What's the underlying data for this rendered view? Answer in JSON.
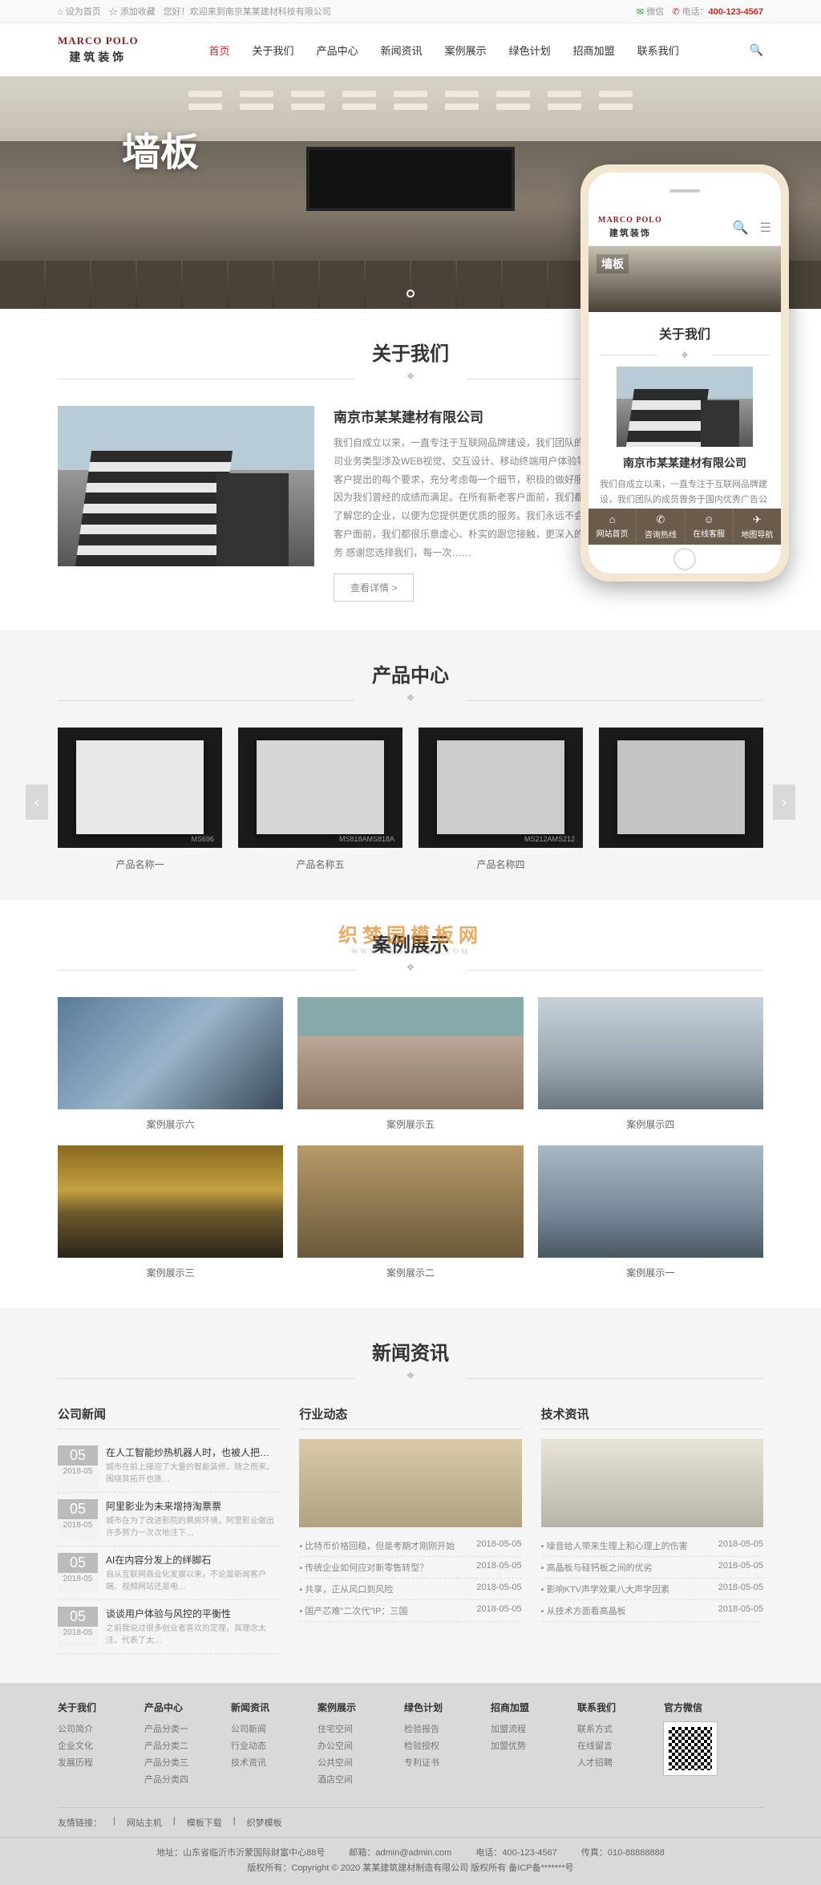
{
  "topbar": {
    "set_home": "设为首页",
    "add_fav": "添加收藏",
    "welcome": "您好！欢迎来到南京某某建材科技有限公司",
    "wechat": "微信",
    "phone_label": "电话：",
    "phone": "400-123-4567"
  },
  "logo": {
    "top": "MARCO POLO",
    "bot": "建筑装饰"
  },
  "nav": [
    "首页",
    "关于我们",
    "产品中心",
    "新闻资讯",
    "案例展示",
    "绿色计划",
    "招商加盟",
    "联系我们"
  ],
  "banner": {
    "title": "墙板"
  },
  "about": {
    "sec": "关于我们",
    "company": "南京市某某建材有限公司",
    "desc": "我们自成立以来，一直专注于互联网品牌建设，我们团队的成员曾务于国内优秀广告公司及互联网公司业务类型涉及WEB视觉、交互设计、移动终端用户体验等质量和信誉是我们存在的基石。我们注重客户提出的每个要求，充分考虑每一个细节，积极的做好服务，努力开拓更好的视野。我们永远不会因为我们曾经的成绩而满足。在所有新老客户面前，我们都很乐意虚心、朴实的跟您接触，更深入的了解您的企业，以便为您提供更优质的服务。我们永远不会因为我们曾经的成绩而满足。在所有新老客户面前，我们都很乐意虚心、朴实的跟您接触，更深入的了解您的企业，以便为您提供更优质的服务 感谢您选择我们，每一次……",
    "btn": "查看详情 >"
  },
  "phone": {
    "about": "关于我们",
    "company": "南京市某某建材有限公司",
    "desc": "我们自成立以来，一直专注于互联网品牌建设，我们团队的成员曾务于国内优秀广告公司及互联网公司业务类型涉及WEB视觉、交互设计、移动终端用户体验等质量和信誉是我们存在的基石。我们注重客户提出的每个要求，充分考虑每一个细节，积极的做好服务，努力开拓更好的视野。我们永远不会因为我们曾经的成绩而满足。在所有新老客户面前，我们都",
    "tabs": [
      {
        "icon": "⌂",
        "t": "网站首页"
      },
      {
        "icon": "✆",
        "t": "咨询热线"
      },
      {
        "icon": "☺",
        "t": "在线客服"
      },
      {
        "icon": "✈",
        "t": "地图导航"
      }
    ]
  },
  "products": {
    "sec": "产品中心",
    "items": [
      {
        "code": "MS696",
        "name": "产品名称一"
      },
      {
        "code": "MS818AMS818A",
        "name": "产品名称五"
      },
      {
        "code": "MS212AMS212",
        "name": "产品名称四"
      },
      {
        "code": "",
        "name": ""
      }
    ]
  },
  "cases": {
    "sec": "案例展示",
    "items": [
      "案例展示六",
      "案例展示五",
      "案例展示四",
      "案例展示三",
      "案例展示二",
      "案例展示一"
    ]
  },
  "news": {
    "sec": "新闻资讯",
    "cols": [
      {
        "title": "公司新闻",
        "date_day": "05",
        "date_ym": "2018-05",
        "items": [
          {
            "t": "在人工智能炒热机器人时，也被人把…",
            "d": "城市在前上接迎了大量的智能装修，随之而来，围绕其拓开也逐…"
          },
          {
            "t": "阿里影业为未来增持淘票票",
            "d": "城市在为了改进影院的票房环境，阿里影业做出许多努力一次次地注下…"
          },
          {
            "t": "AI在内容分发上的绊脚石",
            "d": "自从互联网商业化发展以来，不论是新闻客户端、视频网站还是电…"
          },
          {
            "t": "谈谈用户体验与风控的平衡性",
            "d": "之前我说过很多创业者喜欢的定理，其理念太注、代表了太…"
          }
        ]
      },
      {
        "title": "行业动态",
        "links": [
          {
            "t": "比特币价格回稳，但是考期才刚刚开始",
            "d": "2018-05-05"
          },
          {
            "t": "传统企业如何应对新零售转型？",
            "d": "2018-05-05"
          },
          {
            "t": "共享，正从风口到风险",
            "d": "2018-05-05"
          },
          {
            "t": "国产芯难\"二次代\"IP：三国",
            "d": "2018-05-05"
          }
        ]
      },
      {
        "title": "技术资讯",
        "links": [
          {
            "t": "噪音给人带来生理上和心理上的伤害",
            "d": "2018-05-05"
          },
          {
            "t": "高晶板与硅钙板之间的优劣",
            "d": "2018-05-05"
          },
          {
            "t": "影响KTV声学效果八大声学因素",
            "d": "2018-05-05"
          },
          {
            "t": "从技术方面看高晶板",
            "d": "2018-05-05"
          }
        ]
      }
    ]
  },
  "footer": {
    "cols": [
      {
        "t": "关于我们",
        "l": [
          "公司简介",
          "企业文化",
          "发展历程"
        ]
      },
      {
        "t": "产品中心",
        "l": [
          "产品分类一",
          "产品分类二",
          "产品分类三",
          "产品分类四"
        ]
      },
      {
        "t": "新闻资讯",
        "l": [
          "公司新闻",
          "行业动态",
          "技术资讯"
        ]
      },
      {
        "t": "案例展示",
        "l": [
          "住宅空间",
          "办公空间",
          "公共空间",
          "酒店空间"
        ]
      },
      {
        "t": "绿色计划",
        "l": [
          "检验报告",
          "检验授权",
          "专利证书"
        ]
      },
      {
        "t": "招商加盟",
        "l": [
          "加盟流程",
          "加盟优势"
        ]
      },
      {
        "t": "联系我们",
        "l": [
          "联系方式",
          "在线留言",
          "人才招聘"
        ]
      },
      {
        "t": "官方微信",
        "l": []
      }
    ],
    "links_label": "友情链接：",
    "links": [
      "|",
      "网站主机",
      "|",
      "模板下载",
      "|",
      "织梦模板"
    ],
    "addr": "地址：山东省临沂市沂蒙国际财富中心88号",
    "email": "邮箱：admin@admin.com",
    "tel": "电话：400-123-4567",
    "fax": "传真：010-88888888",
    "copy": "版权所有：Copyright © 2020 某某建筑建材制造有限公司 版权所有 备ICP备*******号"
  },
  "watermark": {
    "t1": "织梦园模板网",
    "t2": "WWW.DEDEYUAN.COM"
  }
}
